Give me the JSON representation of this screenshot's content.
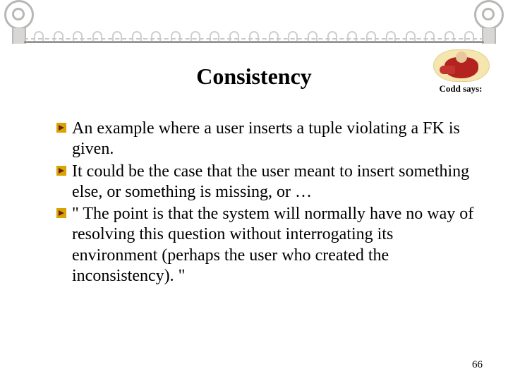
{
  "title": "Consistency",
  "caption": "Codd says:",
  "bullets": {
    "b0": "An example where a user inserts a tuple violating a FK is given.",
    "b1": "It could be the case that the user meant to insert something else, or something is missing, or …",
    "b2": "\" The point is that the system will normally have no way of resolving this question without interrogating its environment (perhaps the user who created the inconsistency). \""
  },
  "page_number": "66"
}
